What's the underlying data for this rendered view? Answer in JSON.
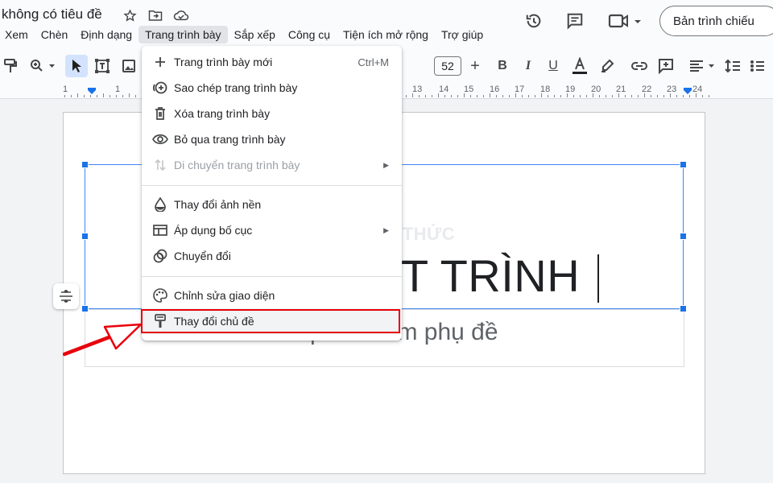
{
  "doc": {
    "title": "không có tiêu đề"
  },
  "header": {
    "slideshow_label": "Bản trình chiếu"
  },
  "menubar": {
    "items": [
      "Xem",
      "Chèn",
      "Định dạng",
      "Trang trình bày",
      "Sắp xếp",
      "Công cụ",
      "Tiện ích mở rộng",
      "Trợ giúp"
    ],
    "active": "Trang trình bày"
  },
  "toolbar": {
    "font_size": "52"
  },
  "ruler": {
    "labels": [
      "1",
      "1",
      "13",
      "14",
      "15",
      "16",
      "17",
      "18",
      "19",
      "20",
      "21",
      "22",
      "23",
      "24"
    ]
  },
  "slide": {
    "title_text": "ẾT TRÌNH",
    "subtitle_text": "Nhấp để thêm phụ đề"
  },
  "watermark": "CHIA SẺ KIẾN THỨC",
  "menu": {
    "items": [
      {
        "label": "Trang trình bày mới",
        "shortcut": "Ctrl+M",
        "icon": "plus-icon"
      },
      {
        "label": "Sao chép trang trình bày",
        "icon": "duplicate-slide-icon"
      },
      {
        "label": "Xóa trang trình bày",
        "icon": "trash-icon"
      },
      {
        "label": "Bỏ qua trang trình bày",
        "icon": "eye-icon"
      },
      {
        "label": "Di chuyển trang trình bày",
        "icon": "move-arrows-icon",
        "disabled": true,
        "submenu": true
      },
      {
        "label": "Thay đổi ảnh nền",
        "icon": "background-drop-icon"
      },
      {
        "label": "Áp dụng bố cục",
        "icon": "layout-icon",
        "submenu": true
      },
      {
        "label": "Chuyển đổi",
        "icon": "transition-icon"
      },
      {
        "label": "Chỉnh sửa giao diện",
        "icon": "palette-icon"
      },
      {
        "label": "Thay đổi chủ đề",
        "icon": "paint-roller-icon",
        "highlighted": true
      }
    ]
  },
  "colors": {
    "accent": "#1a73e8",
    "annotation": "#e8000b",
    "selection": "#4285f4"
  }
}
